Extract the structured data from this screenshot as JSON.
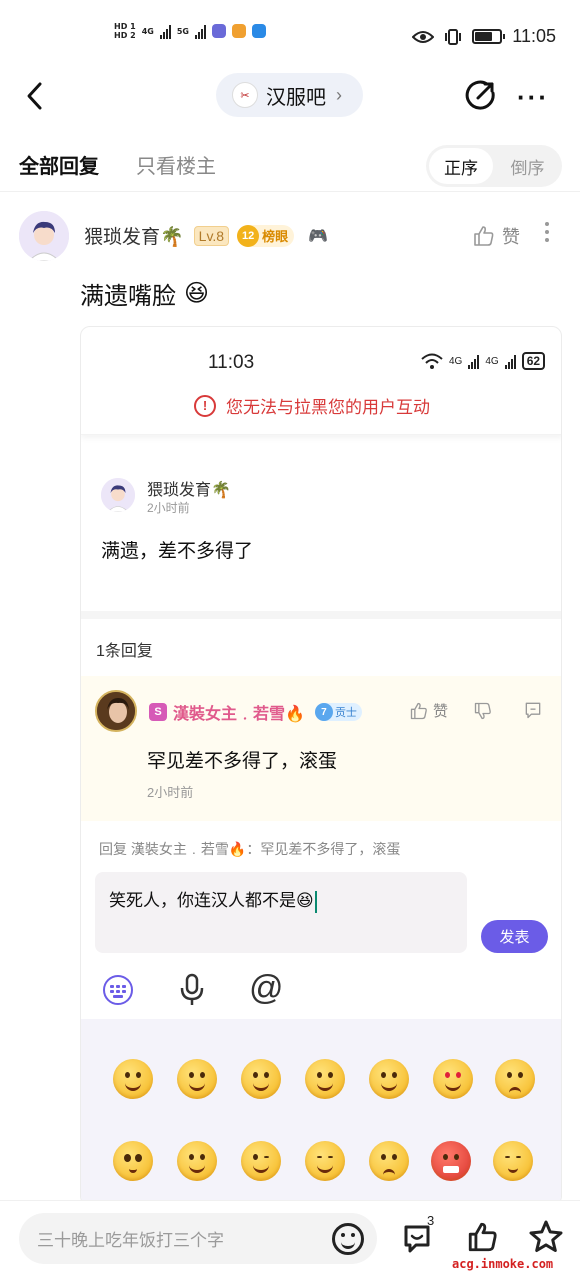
{
  "status_bar": {
    "time": "11:05",
    "sim1": "HD 1",
    "sim2": "HD 2",
    "net1": "4G",
    "net2": "5G",
    "icons": [
      "eye-icon",
      "vibrate-icon",
      "battery-icon"
    ]
  },
  "nav": {
    "forum_name": "汉服吧",
    "forum_arrow": "›",
    "icons": [
      "back-icon",
      "share-icon",
      "more-icon"
    ]
  },
  "tabs": {
    "all_replies": "全部回复",
    "op_only": "只看楼主",
    "order_asc": "正序",
    "order_desc": "倒序"
  },
  "post": {
    "username": "猥琐发育🌴",
    "level": "Lv.8",
    "rank_num": "12",
    "rank_label": "榜眼",
    "like_label": "赞",
    "text": "满遗嘴脸",
    "text_emoji": "😆"
  },
  "embedded": {
    "time": "11:03",
    "net_a": "4G",
    "net_b": "4G",
    "battery": "62",
    "warning": "您无法与拉黑您的用户互动",
    "user": "猥琐发育🌴",
    "post_time": "2小时前",
    "post_text": "满遗，差不多得了",
    "reply_count": "1条回复",
    "reply": {
      "badge": "S",
      "user": "漢裝女主﹒若雪🔥",
      "contrib_level": "7",
      "contrib_label": "贡士",
      "like_label": "赞",
      "text": "罕见差不多得了，滚蛋",
      "time": "2小时前"
    },
    "replying_to": "回复 漢裝女主﹒若雪🔥：罕见差不多得了，滚蛋",
    "compose_text": "笑死人，你连汉人都不是😆",
    "send_label": "发表",
    "tools": [
      "keyboard-icon",
      "microphone-icon",
      "at-icon"
    ],
    "at_symbol": "@"
  },
  "bottom_bar": {
    "placeholder": "三十晚上吃年饭打三个字",
    "comment_count": "3",
    "watermark": "acg.inmoke.com",
    "icons": [
      "emoji-icon",
      "comment-icon",
      "like-icon",
      "star-icon"
    ]
  },
  "colors": {
    "accent": "#6b5ce7",
    "warning": "#d83a3a",
    "reply_bg": "#fffcf1",
    "watermark": "#d42121"
  }
}
